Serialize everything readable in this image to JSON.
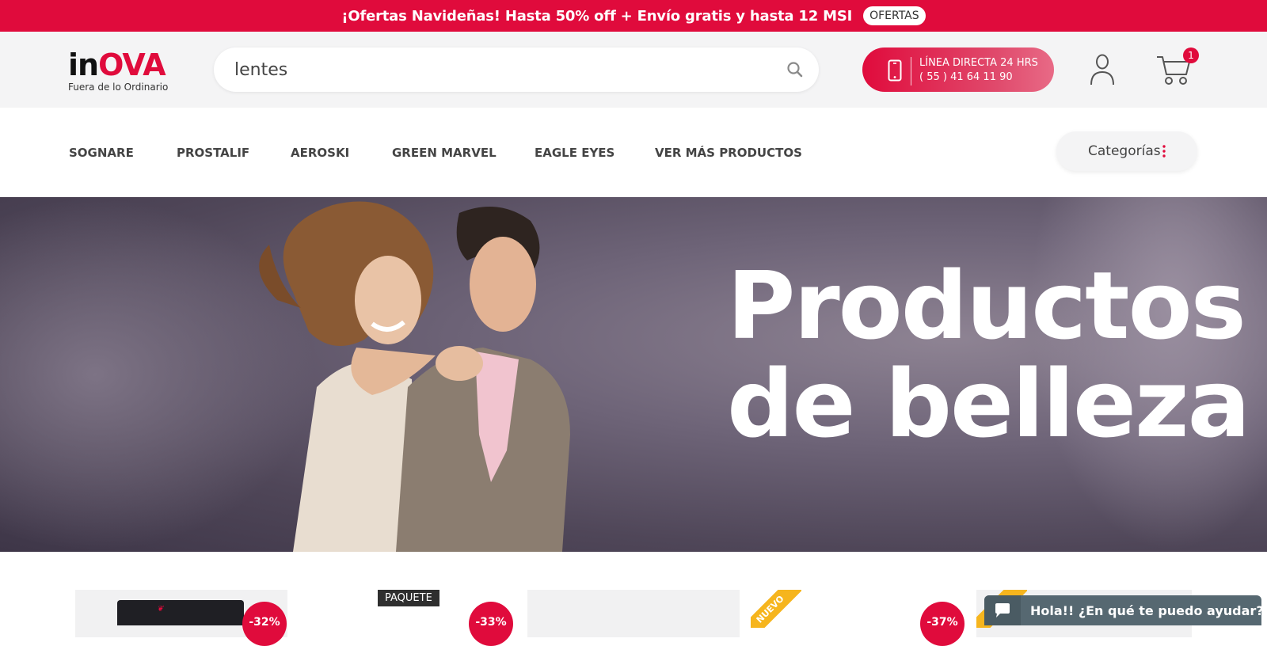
{
  "promo": {
    "text": "¡Ofertas Navideñas! Hasta 50% off + Envío gratis y hasta 12 MSI",
    "button": "OFERTAS"
  },
  "header": {
    "logo": {
      "main_dark": "in",
      "main_red": "OVA",
      "tagline": "Fuera de lo Ordinario"
    },
    "search": {
      "value": "lentes",
      "icon": "search-icon"
    },
    "hotline": {
      "line1": "LÍNEA DIRECTA 24 HRS",
      "line2": "( 55 ) 41 64 11 90",
      "icon": "phone-icon"
    },
    "user_icon": "user-icon",
    "cart": {
      "count": "1",
      "icon": "cart-icon"
    }
  },
  "nav": {
    "items": [
      "SOGNARE",
      "PROSTALIF",
      "AEROSKI",
      "GREEN MARVEL",
      "EAGLE EYES",
      "VER MÁS PRODUCTOS"
    ],
    "categories_label": "Categorías"
  },
  "hero": {
    "line1": "Productos",
    "line2": "de belleza"
  },
  "products": {
    "badges": [
      "-32%",
      "-33%",
      "-37%"
    ],
    "paquete_label": "PAQUETE",
    "nuevo_label": "NUEVO"
  },
  "chat": {
    "text": "Hola!! ¿En qué te puedo ayudar?",
    "icon": "chat-bubble-icon"
  },
  "colors": {
    "brand_red": "#e00b3c",
    "header_bg": "#f4f4f5",
    "chat_bg": "#566871",
    "ribbon_yellow": "#f6b51e"
  }
}
